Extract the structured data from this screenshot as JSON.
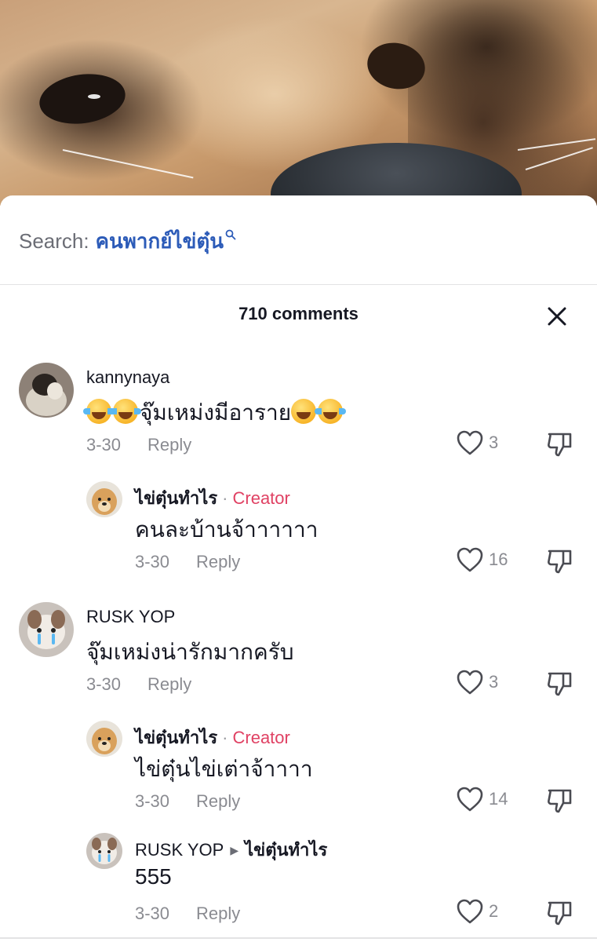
{
  "search": {
    "label": "Search:",
    "term": "คนพากย์ไข่ตุ๋น"
  },
  "header": {
    "title": "710 comments"
  },
  "comments": [
    {
      "username": "kannynaya",
      "text": "จุ๊มเหม่งมีอาราย",
      "emoji_before": [
        "face-with-tears-of-joy",
        "face-with-tears-of-joy"
      ],
      "emoji_after": [
        "grinning-face-with-smiling-eyes",
        "face-with-tears-of-joy"
      ],
      "date": "3-30",
      "reply_label": "Reply",
      "likes": "3"
    },
    {
      "username": "ไข่ตุ๋นทำไร",
      "badge": "Creator",
      "text": "คนละบ้านจ้าาาาาา",
      "date": "3-30",
      "reply_label": "Reply",
      "likes": "16"
    },
    {
      "username": "RUSK YOP",
      "text": "จุ๊มเหม่งน่ารักมากครับ",
      "date": "3-30",
      "reply_label": "Reply",
      "likes": "3"
    },
    {
      "username": "ไข่ตุ๋นทำไร",
      "badge": "Creator",
      "text": "ไข่ตุ๋นไข่เต่าจ้าาาา",
      "date": "3-30",
      "reply_label": "Reply",
      "likes": "14"
    },
    {
      "username": "RUSK YOP",
      "reply_to": "ไข่ตุ๋นทำไร",
      "text": "555",
      "date": "3-30",
      "reply_label": "Reply",
      "likes": "2"
    }
  ],
  "icons": {
    "like": "heart-outline-icon",
    "dislike": "thumbs-down-icon",
    "close": "close-icon",
    "search": "search-icon"
  },
  "colors": {
    "search_term": "#2c5bb8",
    "creator_badge": "#e04163",
    "meta_text": "#8a8b91"
  }
}
